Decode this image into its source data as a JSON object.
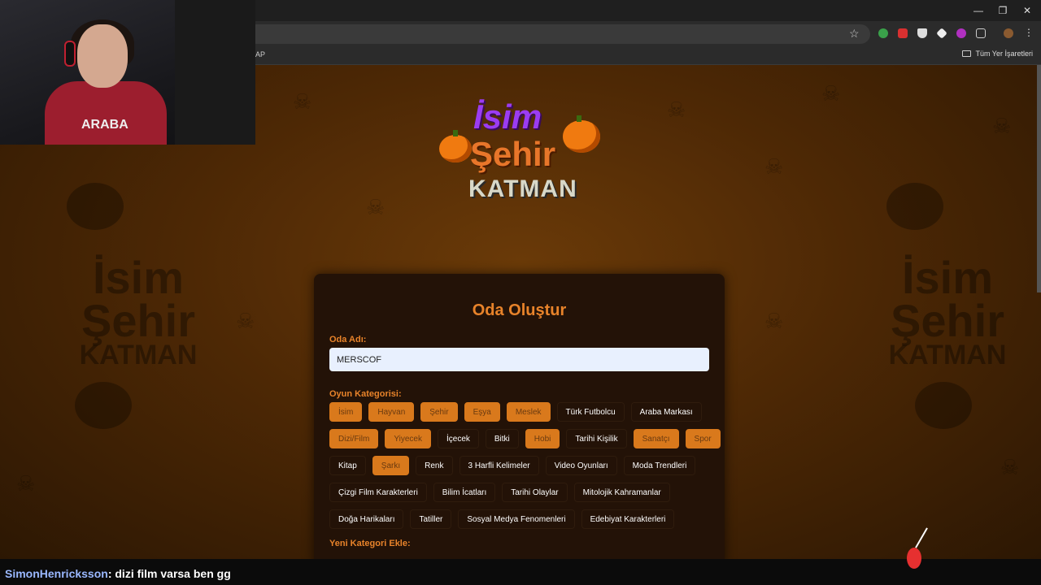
{
  "browser": {
    "bookmark_left": "AP",
    "bookmark_right": "Tüm Yer İşaretleri",
    "window_controls": [
      "—",
      "❐",
      "✕"
    ]
  },
  "logo": {
    "line1": "İsim",
    "line2": "Şehir",
    "line3": "KATMAN"
  },
  "background": {
    "logo_line1": "İsim",
    "logo_line2": "Şehir",
    "logo_line3": "KATMAN"
  },
  "form": {
    "title": "Oda Oluştur",
    "room_label": "Oda Adı:",
    "room_value": "MERSCOF",
    "category_label": "Oyun Kategorisi:",
    "new_category_label": "Yeni Kategori Ekle:",
    "category_rows": [
      [
        {
          "label": "İsim",
          "active": true
        },
        {
          "label": "Hayvan",
          "active": true
        },
        {
          "label": "Şehir",
          "active": true
        },
        {
          "label": "Eşya",
          "active": true
        },
        {
          "label": "Meslek",
          "active": true
        },
        {
          "label": "Türk Futbolcu",
          "active": false
        },
        {
          "label": "Araba Markası",
          "active": false
        }
      ],
      [
        {
          "label": "Dizi/Film",
          "active": true
        },
        {
          "label": "Yiyecek",
          "active": true
        },
        {
          "label": "İçecek",
          "active": false
        },
        {
          "label": "Bitki",
          "active": false
        },
        {
          "label": "Hobi",
          "active": true
        },
        {
          "label": "Tarihi Kişilik",
          "active": false
        },
        {
          "label": "Sanatçı",
          "active": true
        },
        {
          "label": "Spor",
          "active": true
        }
      ],
      [
        {
          "label": "Kitap",
          "active": false
        },
        {
          "label": "Şarkı",
          "active": true
        },
        {
          "label": "Renk",
          "active": false
        },
        {
          "label": "3 Harfli Kelimeler",
          "active": false
        },
        {
          "label": "Video Oyunları",
          "active": false
        },
        {
          "label": "Moda Trendleri",
          "active": false
        }
      ],
      [
        {
          "label": "Çizgi Film Karakterleri",
          "active": false
        },
        {
          "label": "Bilim İcatları",
          "active": false
        },
        {
          "label": "Tarihi Olaylar",
          "active": false
        },
        {
          "label": "Mitolojik Kahramanlar",
          "active": false
        }
      ],
      [
        {
          "label": "Doğa Harikaları",
          "active": false
        },
        {
          "label": "Tatiller",
          "active": false
        },
        {
          "label": "Sosyal Medya Fenomenleri",
          "active": false
        },
        {
          "label": "Edebiyat Karakterleri",
          "active": false
        }
      ]
    ]
  },
  "webcam": {
    "hoodie_text": "ARABA"
  },
  "chat": {
    "user": "SimonHenricksson",
    "message": ": dizi film varsa ben gg"
  },
  "colors": {
    "accent": "#e8832a",
    "active_chip": "#d9791c",
    "card_bg": "#231207",
    "chat_user": "#9ab8ff"
  }
}
